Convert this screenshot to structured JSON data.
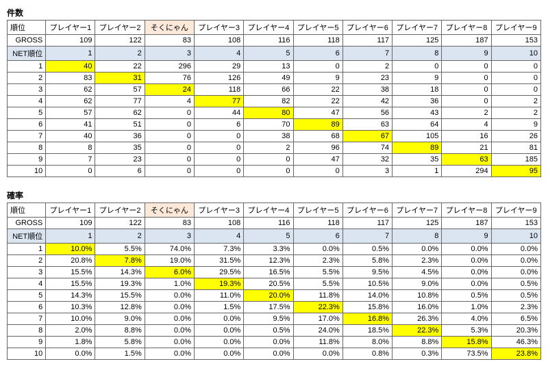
{
  "labels": {
    "rank": "順位",
    "gross": "GROSS",
    "netrank": "NET順位"
  },
  "players": [
    "プレイヤー1",
    "プレイヤー2",
    "そくにゃん",
    "プレイヤー3",
    "プレイヤー4",
    "プレイヤー5",
    "プレイヤー6",
    "プレイヤー7",
    "プレイヤー8",
    "プレイヤー9"
  ],
  "special_col": 2,
  "count": {
    "title": "件数",
    "gross": [
      109,
      122,
      83,
      108,
      116,
      118,
      117,
      125,
      187,
      153
    ],
    "net": [
      1,
      2,
      3,
      4,
      5,
      6,
      7,
      8,
      9,
      10
    ],
    "rows": [
      {
        "rank": 1,
        "v": [
          40,
          22,
          296,
          29,
          13,
          0,
          2,
          0,
          0,
          0
        ],
        "hl": [
          0
        ]
      },
      {
        "rank": 2,
        "v": [
          83,
          31,
          76,
          126,
          49,
          9,
          23,
          9,
          0,
          0
        ],
        "hl": [
          1
        ]
      },
      {
        "rank": 3,
        "v": [
          62,
          57,
          24,
          118,
          66,
          22,
          38,
          18,
          0,
          0
        ],
        "hl": [
          2
        ]
      },
      {
        "rank": 4,
        "v": [
          62,
          77,
          4,
          77,
          82,
          22,
          42,
          36,
          0,
          2
        ],
        "hl": [
          3
        ]
      },
      {
        "rank": 5,
        "v": [
          57,
          62,
          0,
          44,
          80,
          47,
          56,
          43,
          2,
          2
        ],
        "hl": [
          4
        ]
      },
      {
        "rank": 6,
        "v": [
          41,
          51,
          0,
          6,
          70,
          89,
          63,
          64,
          4,
          9
        ],
        "hl": [
          5
        ]
      },
      {
        "rank": 7,
        "v": [
          40,
          36,
          0,
          0,
          38,
          68,
          67,
          105,
          16,
          26
        ],
        "hl": [
          6
        ]
      },
      {
        "rank": 8,
        "v": [
          8,
          35,
          0,
          0,
          2,
          96,
          74,
          89,
          21,
          81
        ],
        "hl": [
          7
        ]
      },
      {
        "rank": 9,
        "v": [
          7,
          23,
          0,
          0,
          0,
          47,
          32,
          35,
          63,
          185
        ],
        "hl": [
          8
        ]
      },
      {
        "rank": 10,
        "v": [
          0,
          6,
          0,
          0,
          0,
          0,
          3,
          1,
          294,
          95
        ],
        "hl": [
          9
        ]
      }
    ]
  },
  "rate": {
    "title": "確率",
    "gross": [
      109,
      122,
      83,
      108,
      116,
      118,
      117,
      125,
      187,
      153
    ],
    "net": [
      1,
      2,
      3,
      4,
      5,
      6,
      7,
      8,
      9,
      10
    ],
    "rows": [
      {
        "rank": 1,
        "v": [
          "10.0%",
          "5.5%",
          "74.0%",
          "7.3%",
          "3.3%",
          "0.0%",
          "0.5%",
          "0.0%",
          "0.0%",
          "0.0%"
        ],
        "hl": [
          0
        ]
      },
      {
        "rank": 2,
        "v": [
          "20.8%",
          "7.8%",
          "19.0%",
          "31.5%",
          "12.3%",
          "2.3%",
          "5.8%",
          "2.3%",
          "0.0%",
          "0.0%"
        ],
        "hl": [
          1
        ]
      },
      {
        "rank": 3,
        "v": [
          "15.5%",
          "14.3%",
          "6.0%",
          "29.5%",
          "16.5%",
          "5.5%",
          "9.5%",
          "4.5%",
          "0.0%",
          "0.0%"
        ],
        "hl": [
          2
        ]
      },
      {
        "rank": 4,
        "v": [
          "15.5%",
          "19.3%",
          "1.0%",
          "19.3%",
          "20.5%",
          "5.5%",
          "10.5%",
          "9.0%",
          "0.0%",
          "0.5%"
        ],
        "hl": [
          3
        ]
      },
      {
        "rank": 5,
        "v": [
          "14.3%",
          "15.5%",
          "0.0%",
          "11.0%",
          "20.0%",
          "11.8%",
          "14.0%",
          "10.8%",
          "0.5%",
          "0.5%"
        ],
        "hl": [
          4
        ]
      },
      {
        "rank": 6,
        "v": [
          "10.3%",
          "12.8%",
          "0.0%",
          "1.5%",
          "17.5%",
          "22.3%",
          "15.8%",
          "16.0%",
          "1.0%",
          "2.3%"
        ],
        "hl": [
          5
        ]
      },
      {
        "rank": 7,
        "v": [
          "10.0%",
          "9.0%",
          "0.0%",
          "0.0%",
          "9.5%",
          "17.0%",
          "16.8%",
          "26.3%",
          "4.0%",
          "6.5%"
        ],
        "hl": [
          6
        ]
      },
      {
        "rank": 8,
        "v": [
          "2.0%",
          "8.8%",
          "0.0%",
          "0.0%",
          "0.5%",
          "24.0%",
          "18.5%",
          "22.3%",
          "5.3%",
          "20.3%"
        ],
        "hl": [
          7
        ]
      },
      {
        "rank": 9,
        "v": [
          "1.8%",
          "5.8%",
          "0.0%",
          "0.0%",
          "0.0%",
          "11.8%",
          "8.0%",
          "8.8%",
          "15.8%",
          "46.3%"
        ],
        "hl": [
          8
        ]
      },
      {
        "rank": 10,
        "v": [
          "0.0%",
          "1.5%",
          "0.0%",
          "0.0%",
          "0.0%",
          "0.0%",
          "0.8%",
          "0.3%",
          "73.5%",
          "23.8%"
        ],
        "hl": [
          9
        ]
      }
    ]
  },
  "chart_data": [
    {
      "type": "table",
      "title": "件数",
      "columns": [
        "順位",
        "プレイヤー1",
        "プレイヤー2",
        "そくにゃん",
        "プレイヤー3",
        "プレイヤー4",
        "プレイヤー5",
        "プレイヤー6",
        "プレイヤー7",
        "プレイヤー8",
        "プレイヤー9"
      ],
      "gross": [
        109,
        122,
        83,
        108,
        116,
        118,
        117,
        125,
        187,
        153
      ],
      "net_rank": [
        1,
        2,
        3,
        4,
        5,
        6,
        7,
        8,
        9,
        10
      ],
      "data": [
        [
          40,
          22,
          296,
          29,
          13,
          0,
          2,
          0,
          0,
          0
        ],
        [
          83,
          31,
          76,
          126,
          49,
          9,
          23,
          9,
          0,
          0
        ],
        [
          62,
          57,
          24,
          118,
          66,
          22,
          38,
          18,
          0,
          0
        ],
        [
          62,
          77,
          4,
          77,
          82,
          22,
          42,
          36,
          0,
          2
        ],
        [
          57,
          62,
          0,
          44,
          80,
          47,
          56,
          43,
          2,
          2
        ],
        [
          41,
          51,
          0,
          6,
          70,
          89,
          63,
          64,
          4,
          9
        ],
        [
          40,
          36,
          0,
          0,
          38,
          68,
          67,
          105,
          16,
          26
        ],
        [
          8,
          35,
          0,
          0,
          2,
          96,
          74,
          89,
          21,
          81
        ],
        [
          7,
          23,
          0,
          0,
          0,
          47,
          32,
          35,
          63,
          185
        ],
        [
          0,
          6,
          0,
          0,
          0,
          0,
          3,
          1,
          294,
          95
        ]
      ]
    },
    {
      "type": "table",
      "title": "確率",
      "columns": [
        "順位",
        "プレイヤー1",
        "プレイヤー2",
        "そくにゃん",
        "プレイヤー3",
        "プレイヤー4",
        "プレイヤー5",
        "プレイヤー6",
        "プレイヤー7",
        "プレイヤー8",
        "プレイヤー9"
      ],
      "gross": [
        109,
        122,
        83,
        108,
        116,
        118,
        117,
        125,
        187,
        153
      ],
      "net_rank": [
        1,
        2,
        3,
        4,
        5,
        6,
        7,
        8,
        9,
        10
      ],
      "data": [
        [
          10.0,
          5.5,
          74.0,
          7.3,
          3.3,
          0.0,
          0.5,
          0.0,
          0.0,
          0.0
        ],
        [
          20.8,
          7.8,
          19.0,
          31.5,
          12.3,
          2.3,
          5.8,
          2.3,
          0.0,
          0.0
        ],
        [
          15.5,
          14.3,
          6.0,
          29.5,
          16.5,
          5.5,
          9.5,
          4.5,
          0.0,
          0.0
        ],
        [
          15.5,
          19.3,
          1.0,
          19.3,
          20.5,
          5.5,
          10.5,
          9.0,
          0.0,
          0.5
        ],
        [
          14.3,
          15.5,
          0.0,
          11.0,
          20.0,
          11.8,
          14.0,
          10.8,
          0.5,
          0.5
        ],
        [
          10.3,
          12.8,
          0.0,
          1.5,
          17.5,
          22.3,
          15.8,
          16.0,
          1.0,
          2.3
        ],
        [
          10.0,
          9.0,
          0.0,
          0.0,
          9.5,
          17.0,
          16.8,
          26.3,
          4.0,
          6.5
        ],
        [
          2.0,
          8.8,
          0.0,
          0.0,
          0.5,
          24.0,
          18.5,
          22.3,
          5.3,
          20.3
        ],
        [
          1.8,
          5.8,
          0.0,
          0.0,
          0.0,
          11.8,
          8.0,
          8.8,
          15.8,
          46.3
        ],
        [
          0.0,
          1.5,
          0.0,
          0.0,
          0.0,
          0.0,
          0.8,
          0.3,
          73.5,
          23.8
        ]
      ]
    }
  ]
}
